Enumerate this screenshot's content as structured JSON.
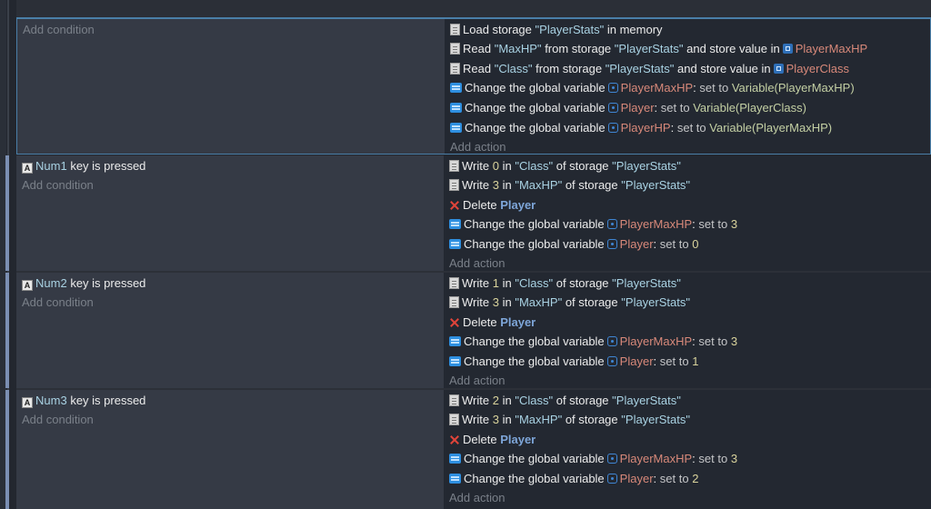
{
  "common": {
    "add_condition": "Add condition",
    "add_action": "Add action",
    "key_is_pressed": "key is pressed",
    "change_global": "Change the global variable",
    "set_to": "set to",
    "write": "Write",
    "in": "in",
    "of_storage": "of storage",
    "delete": "Delete",
    "read": "Read",
    "from_storage": "from storage",
    "and_store_value_in": "and store value in",
    "load_storage": "Load storage",
    "in_memory": "in memory",
    "colon": ":"
  },
  "events": [
    {
      "conditions": [],
      "actions": [
        {
          "type": "load",
          "storage": "\"PlayerStats\""
        },
        {
          "type": "read",
          "key": "\"MaxHP\"",
          "storage": "\"PlayerStats\"",
          "var": "PlayerMaxHP"
        },
        {
          "type": "read",
          "key": "\"Class\"",
          "storage": "\"PlayerStats\"",
          "var": "PlayerClass"
        },
        {
          "type": "change",
          "var": "PlayerMaxHP",
          "value": "Variable(PlayerMaxHP)"
        },
        {
          "type": "change",
          "var": "Player",
          "value": "Variable(PlayerClass)"
        },
        {
          "type": "change",
          "var": "PlayerHP",
          "value": "Variable(PlayerMaxHP)"
        }
      ]
    },
    {
      "conditions": [
        {
          "key": "Num1"
        }
      ],
      "actions": [
        {
          "type": "write",
          "value": "0",
          "key": "\"Class\"",
          "storage": "\"PlayerStats\""
        },
        {
          "type": "write",
          "value": "3",
          "key": "\"MaxHP\"",
          "storage": "\"PlayerStats\""
        },
        {
          "type": "delete",
          "object": "Player"
        },
        {
          "type": "change",
          "var": "PlayerMaxHP",
          "value": "3"
        },
        {
          "type": "change",
          "var": "Player",
          "value": "0"
        }
      ]
    },
    {
      "conditions": [
        {
          "key": "Num2"
        }
      ],
      "actions": [
        {
          "type": "write",
          "value": "1",
          "key": "\"Class\"",
          "storage": "\"PlayerStats\""
        },
        {
          "type": "write",
          "value": "3",
          "key": "\"MaxHP\"",
          "storage": "\"PlayerStats\""
        },
        {
          "type": "delete",
          "object": "Player"
        },
        {
          "type": "change",
          "var": "PlayerMaxHP",
          "value": "3"
        },
        {
          "type": "change",
          "var": "Player",
          "value": "1"
        }
      ]
    },
    {
      "conditions": [
        {
          "key": "Num3"
        }
      ],
      "actions": [
        {
          "type": "write",
          "value": "2",
          "key": "\"Class\"",
          "storage": "\"PlayerStats\""
        },
        {
          "type": "write",
          "value": "3",
          "key": "\"MaxHP\"",
          "storage": "\"PlayerStats\""
        },
        {
          "type": "delete",
          "object": "Player"
        },
        {
          "type": "change",
          "var": "PlayerMaxHP",
          "value": "3"
        },
        {
          "type": "change",
          "var": "Player",
          "value": "2"
        }
      ]
    }
  ]
}
